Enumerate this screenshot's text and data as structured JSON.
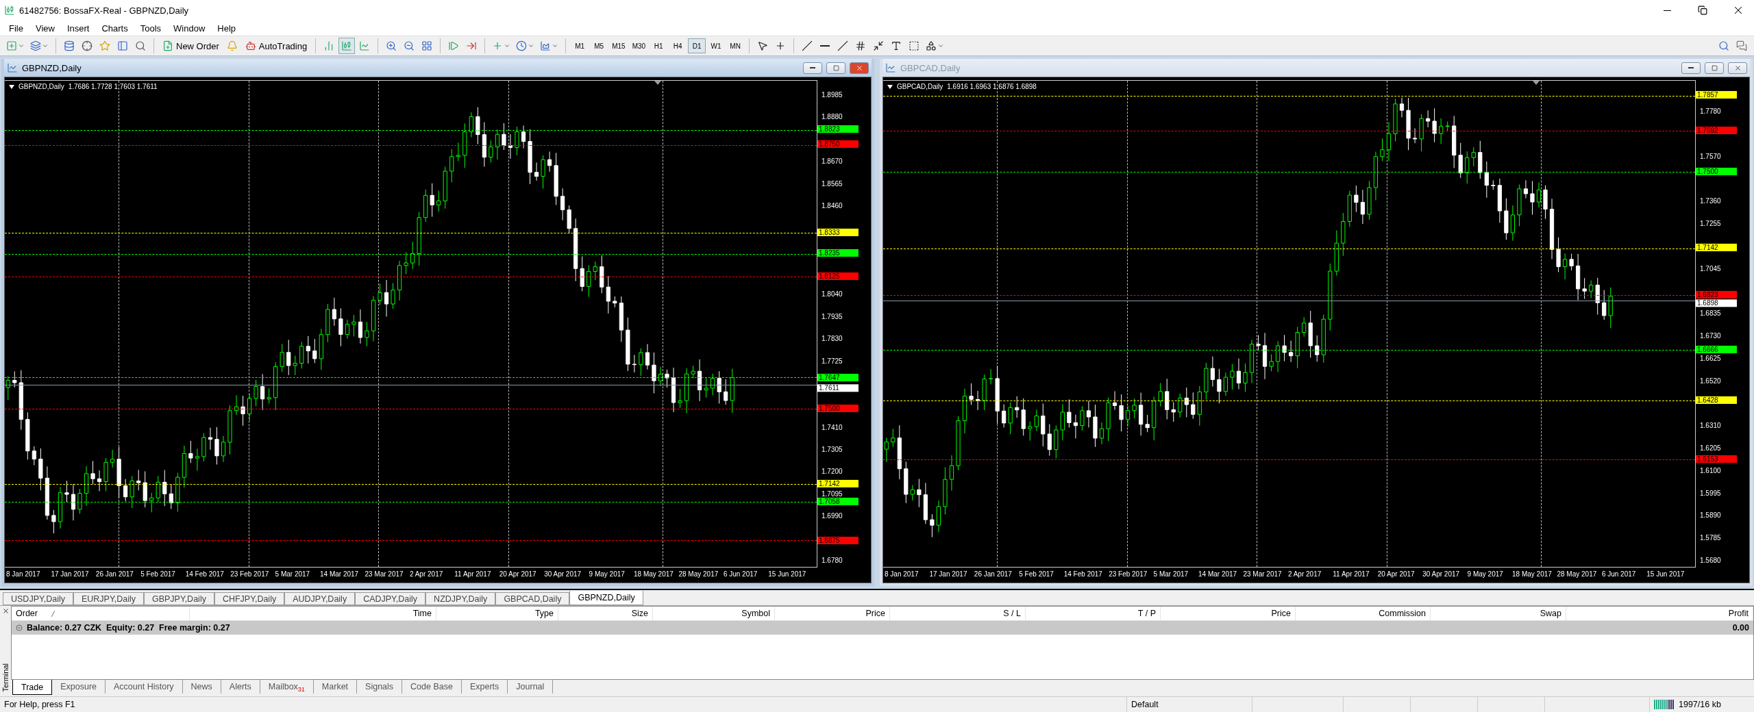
{
  "window": {
    "title": "61482756: BossaFX-Real - GBPNZD,Daily"
  },
  "menu": [
    "File",
    "View",
    "Insert",
    "Charts",
    "Tools",
    "Window",
    "Help"
  ],
  "toolbar": {
    "new_order": "New Order",
    "auto_trading": "AutoTrading",
    "chart_modes": [
      {
        "selected": false
      },
      {
        "selected": true
      },
      {
        "selected": false
      }
    ],
    "timeframes": [
      {
        "label": "M1",
        "selected": false
      },
      {
        "label": "M5",
        "selected": false
      },
      {
        "label": "M15",
        "selected": false
      },
      {
        "label": "M30",
        "selected": false
      },
      {
        "label": "H1",
        "selected": false
      },
      {
        "label": "H4",
        "selected": false
      },
      {
        "label": "D1",
        "selected": true
      },
      {
        "label": "W1",
        "selected": false
      },
      {
        "label": "MN",
        "selected": false
      }
    ]
  },
  "charts": [
    {
      "title": "GBPNZD,Daily",
      "active": true,
      "symbol": "GBPNZD,Daily",
      "ohlc": "1.7686 1.7728 1.7603 1.7611",
      "ticks": [
        "1.8985",
        "1.8880",
        "1.8670",
        "1.8565",
        "1.8460",
        "1.8040",
        "1.7935",
        "1.7830",
        "1.7725",
        "1.7410",
        "1.7305",
        "1.7200",
        "1.7095",
        "1.6990",
        "1.6780"
      ],
      "levels": [
        {
          "kind": "level",
          "price": "1.8823",
          "color": "#00ff00"
        },
        {
          "kind": "level",
          "price": "1.8750",
          "color": "#ff0000"
        },
        {
          "kind": "level",
          "price": "1.8333",
          "color": "#ffff00"
        },
        {
          "kind": "level",
          "price": "1.8235",
          "color": "#00ff00"
        },
        {
          "kind": "level",
          "price": "1.8125",
          "color": "#ff0000"
        },
        {
          "kind": "level",
          "price": "1.7647",
          "color": "#00ff00"
        },
        {
          "kind": "bid",
          "price": "1.7611",
          "color": "#ffffff"
        },
        {
          "kind": "level",
          "price": "1.7500",
          "color": "#ff0000"
        },
        {
          "kind": "level",
          "price": "1.7142",
          "color": "#ffff00"
        },
        {
          "kind": "level",
          "price": "1.7058",
          "color": "#00ff00"
        },
        {
          "kind": "level",
          "price": "1.6875",
          "color": "#ff0000"
        }
      ],
      "dates": [
        "8 Jan 2017",
        "17 Jan 2017",
        "26 Jan 2017",
        "5 Feb 2017",
        "14 Feb 2017",
        "23 Feb 2017",
        "5 Mar 2017",
        "14 Mar 2017",
        "23 Mar 2017",
        "2 Apr 2017",
        "11 Apr 2017",
        "20 Apr 2017",
        "30 Apr 2017",
        "9 May 2017",
        "18 May 2017",
        "28 May 2017",
        "6 Jun 2017",
        "15 Jun 2017"
      ]
    },
    {
      "title": "GBPCAD,Daily",
      "active": false,
      "symbol": "GBPCAD,Daily",
      "ohlc": "1.6916 1.6963 1.6876 1.6898",
      "ticks": [
        "1.7780",
        "1.7570",
        "1.7360",
        "1.7255",
        "1.7045",
        "1.6835",
        "1.6730",
        "1.6625",
        "1.6520",
        "1.6310",
        "1.6205",
        "1.6100",
        "1.5995",
        "1.5890",
        "1.5785",
        "1.5680"
      ],
      "levels": [
        {
          "kind": "level",
          "price": "1.7857",
          "color": "#ffff00"
        },
        {
          "kind": "level",
          "price": "1.7692",
          "color": "#ff0000"
        },
        {
          "kind": "level",
          "price": "1.7500",
          "color": "#00ff00"
        },
        {
          "kind": "level",
          "price": "1.7142",
          "color": "#ffff00"
        },
        {
          "kind": "level",
          "price": "1.6923",
          "color": "#ff0000"
        },
        {
          "kind": "bid",
          "price": "1.6898",
          "color": "#ffffff"
        },
        {
          "kind": "level",
          "price": "1.6666",
          "color": "#00ff00"
        },
        {
          "kind": "level",
          "price": "1.6428",
          "color": "#ffff00"
        },
        {
          "kind": "level",
          "price": "1.6153",
          "color": "#ff0000"
        }
      ],
      "dates": [
        "8 Jan 2017",
        "17 Jan 2017",
        "26 Jan 2017",
        "5 Feb 2017",
        "14 Feb 2017",
        "23 Feb 2017",
        "5 Mar 2017",
        "14 Mar 2017",
        "23 Mar 2017",
        "2 Apr 2017",
        "11 Apr 2017",
        "20 Apr 2017",
        "30 Apr 2017",
        "9 May 2017",
        "18 May 2017",
        "28 May 2017",
        "6 Jun 2017",
        "15 Jun 2017"
      ]
    }
  ],
  "chart_tabs": [
    {
      "label": "USDJPY,Daily",
      "selected": false
    },
    {
      "label": "EURJPY,Daily",
      "selected": false
    },
    {
      "label": "GBPJPY,Daily",
      "selected": false
    },
    {
      "label": "CHFJPY,Daily",
      "selected": false
    },
    {
      "label": "AUDJPY,Daily",
      "selected": false
    },
    {
      "label": "CADJPY,Daily",
      "selected": false
    },
    {
      "label": "NZDJPY,Daily",
      "selected": false
    },
    {
      "label": "GBPCAD,Daily",
      "selected": false
    },
    {
      "label": "GBPNZD,Daily",
      "selected": true
    }
  ],
  "terminal": {
    "label": "Terminal",
    "columns": [
      "Order",
      "Time",
      "Type",
      "Size",
      "Symbol",
      "Price",
      "S / L",
      "T / P",
      "Price",
      "Commission",
      "Swap",
      "Profit"
    ],
    "balance": "Balance: 0.27 CZK  Equity: 0.27  Free margin: 0.27",
    "profit": "0.00",
    "tabs": [
      {
        "label": "Trade",
        "selected": true
      },
      {
        "label": "Exposure",
        "selected": false
      },
      {
        "label": "Account History",
        "selected": false
      },
      {
        "label": "News",
        "selected": false
      },
      {
        "label": "Alerts",
        "selected": false
      },
      {
        "label": "Mailbox",
        "badge": "31",
        "selected": false
      },
      {
        "label": "Market",
        "selected": false
      },
      {
        "label": "Signals",
        "selected": false
      },
      {
        "label": "Code Base",
        "selected": false
      },
      {
        "label": "Experts",
        "selected": false
      },
      {
        "label": "Journal",
        "selected": false
      }
    ]
  },
  "status_bar": {
    "help": "For Help, press F1",
    "profile": "Default",
    "traffic": "1997/16 kb"
  }
}
